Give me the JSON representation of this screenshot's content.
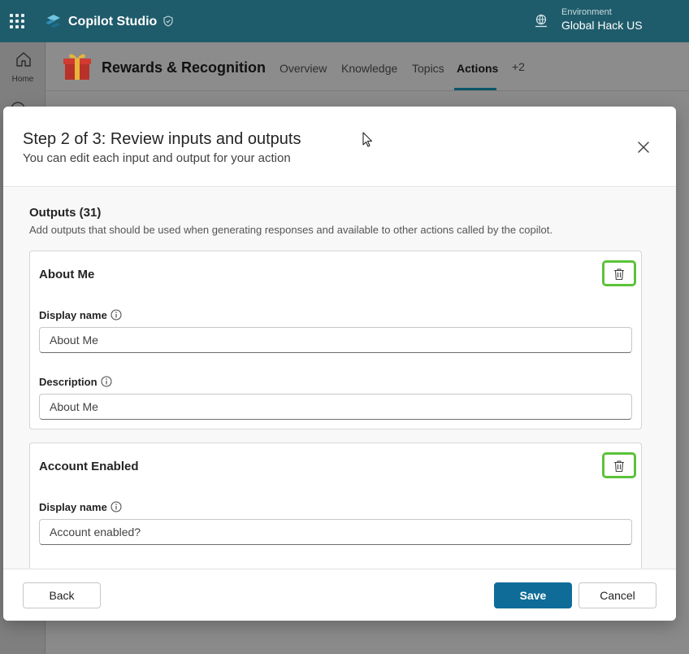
{
  "topbar": {
    "app_name": "Copilot Studio",
    "environment_label": "Environment",
    "environment_name": "Global Hack US"
  },
  "rail": {
    "home_label": "Home"
  },
  "agent": {
    "title": "Rewards & Recognition",
    "tabs": [
      {
        "label": "Overview"
      },
      {
        "label": "Knowledge"
      },
      {
        "label": "Topics"
      },
      {
        "label": "Actions",
        "active": true
      },
      {
        "label": "+2"
      }
    ]
  },
  "modal": {
    "title": "Step 2 of 3: Review inputs and outputs",
    "subtitle": "You can edit each input and output for your action",
    "outputs_title": "Outputs (31)",
    "outputs_desc": "Add outputs that should be used when generating responses and available to other actions called by the copilot.",
    "cards": [
      {
        "title": "About Me",
        "display_name_label": "Display name",
        "display_name_value": "About Me",
        "description_label": "Description",
        "description_value": "About Me"
      },
      {
        "title": "Account Enabled",
        "display_name_label": "Display name",
        "display_name_value": "Account enabled?"
      }
    ],
    "footer": {
      "back_label": "Back",
      "save_label": "Save",
      "cancel_label": "Cancel"
    }
  },
  "colors": {
    "topbar": "#1f5c6b",
    "primary_button": "#0f6c99",
    "highlight": "#5cc23a"
  }
}
